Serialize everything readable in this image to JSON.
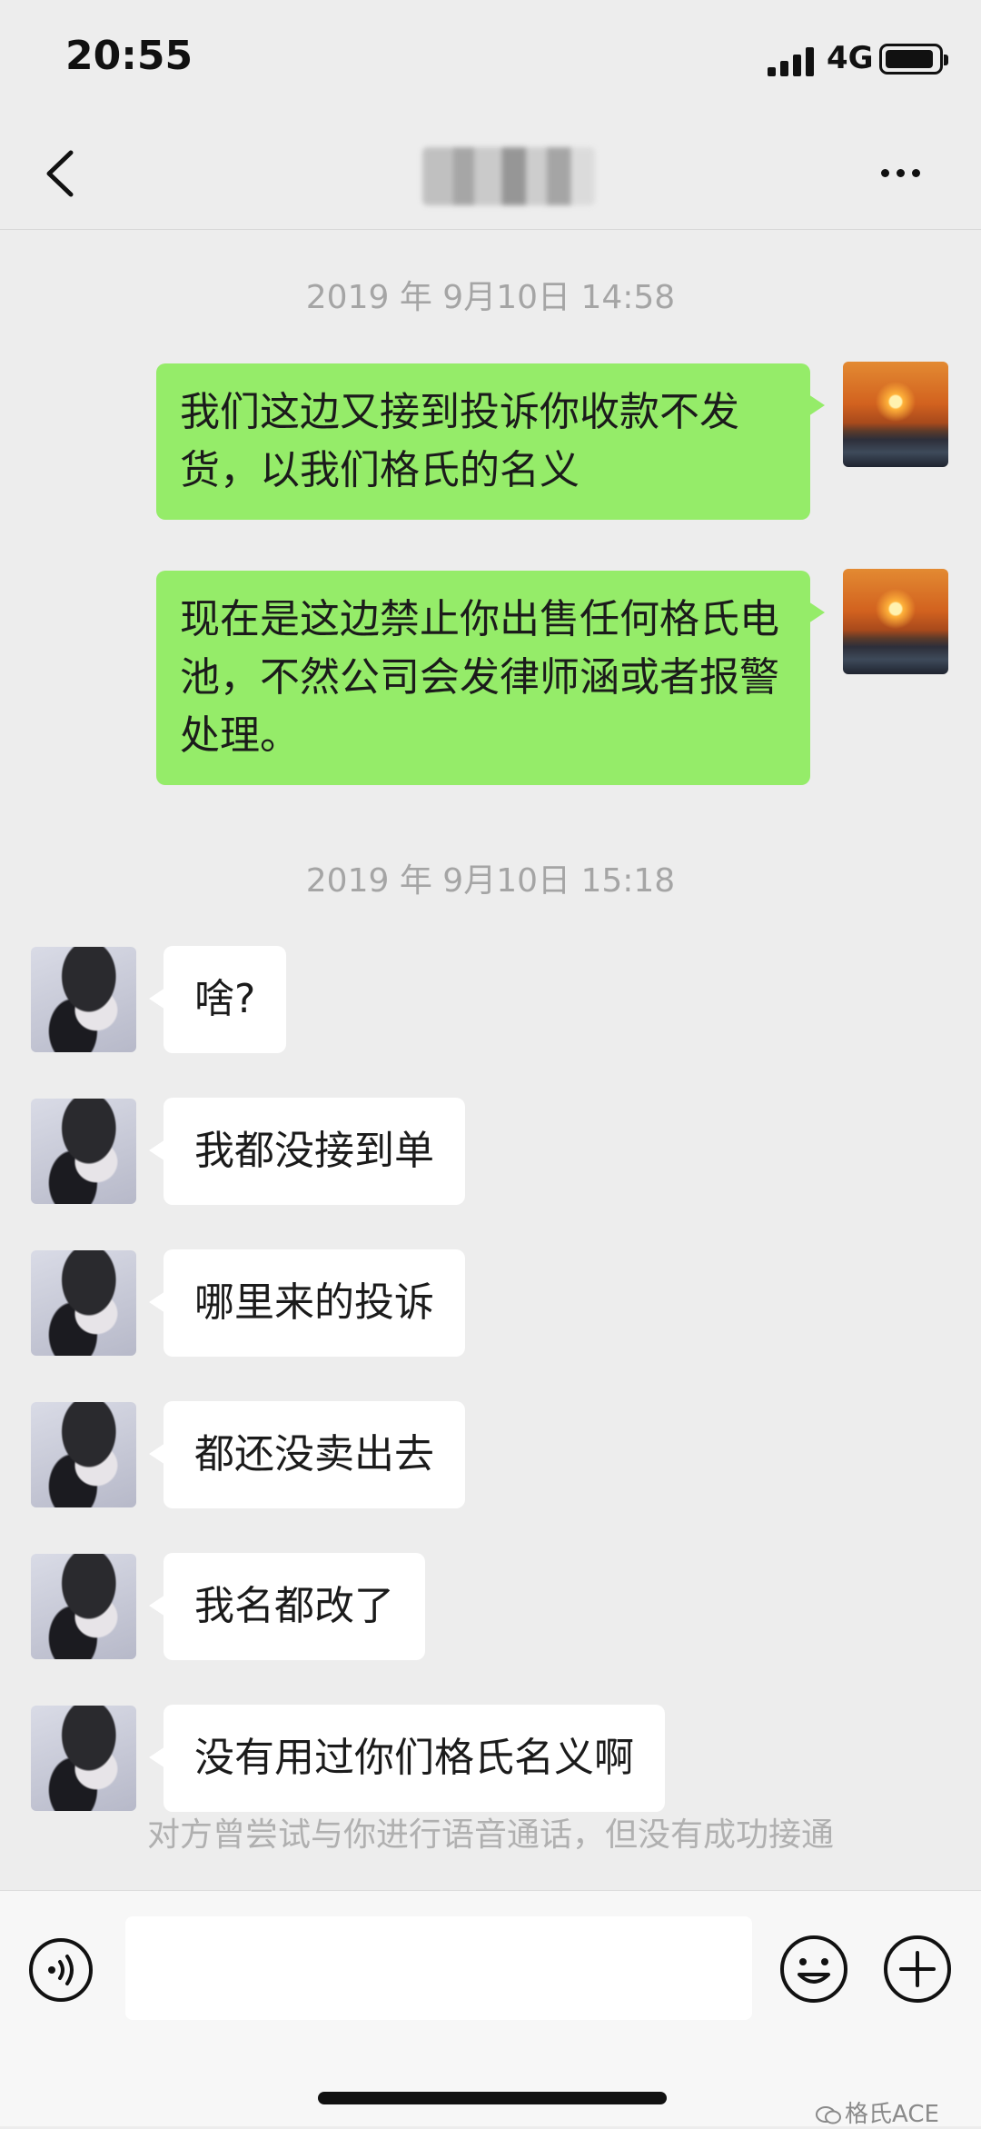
{
  "status_bar": {
    "time": "20:55",
    "network": "4G"
  },
  "header": {
    "back_icon": "chevron-left-icon",
    "more_icon": "ellipsis-icon"
  },
  "timestamps": [
    "2019 年 9月10日 14:58",
    "2019 年 9月10日 15:18"
  ],
  "outgoing_messages": [
    "我们这边又接到投诉你收款不发货，以我们格氏的名义",
    "现在是这边禁止你出售任何格氏电池，不然公司会发律师涵或者报警处理。"
  ],
  "incoming_messages": [
    "啥?",
    "我都没接到单",
    "哪里来的投诉",
    "都还没卖出去",
    "我名都改了",
    "没有用过你们格氏名义啊"
  ],
  "system_note": "对方曾尝试与你进行语音通话，但没有成功接通",
  "input_bar": {
    "voice_icon": "voice-icon",
    "emoji_icon": "emoji-icon",
    "add_icon": "plus-icon"
  },
  "watermark": "格氏ACE"
}
